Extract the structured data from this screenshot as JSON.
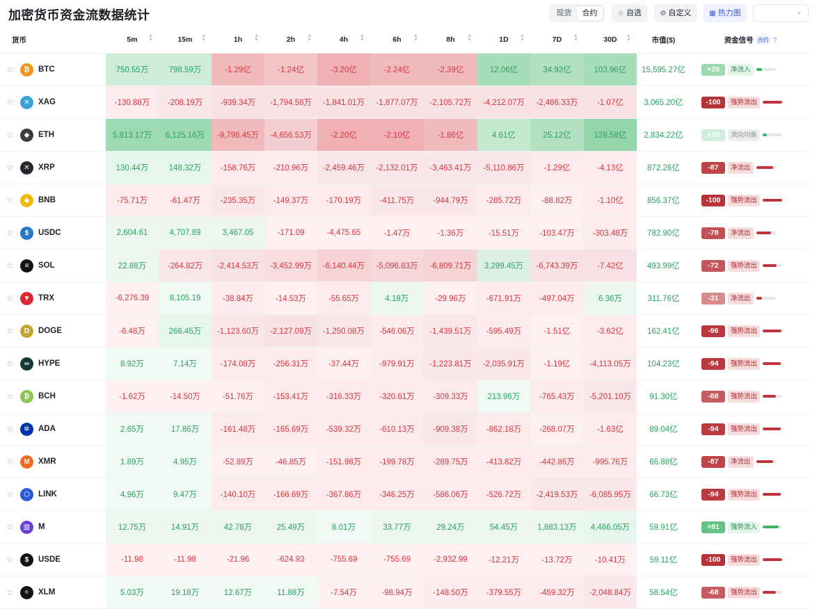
{
  "title": "加密货币资金流数据统计",
  "toolbar": {
    "segments": [
      "现货",
      "合约"
    ],
    "active_segment": 1,
    "watchlist": "自选",
    "custom": "自定义",
    "heatmap": "热力图",
    "select_value": ""
  },
  "colors": {
    "positive_text": "#27a35f",
    "negative_text": "#d9363e",
    "positive_rgb": "60,180,100",
    "negative_rgb": "214,60,70"
  },
  "table": {
    "coin_header": "货币",
    "columns": [
      "5m",
      "15m",
      "1h",
      "2h",
      "4h",
      "6h",
      "8h",
      "1D",
      "7D",
      "30D"
    ],
    "mcap_header": "市值($)",
    "signal_header": "资金信号",
    "signal_badge": "合约",
    "signal_help": "?",
    "rows": [
      {
        "symbol": "BTC",
        "icon": "bitcoin-icon",
        "icon_char": "₿",
        "icon_color": "#f7931a",
        "cells": [
          "750.55万",
          "798.59万",
          "-1.29亿",
          "-1.24亿",
          "-3.20亿",
          "-2.24亿",
          "-2.39亿",
          "12.06亿",
          "34.93亿",
          "103.96亿"
        ],
        "intensity": [
          0.25,
          0.25,
          0.35,
          0.3,
          0.4,
          0.35,
          0.35,
          0.45,
          0.4,
          0.45
        ],
        "mcap": "15,595.27亿",
        "score": "+29",
        "signal": "净流入",
        "signal_type": "in",
        "signal_level": 0.29
      },
      {
        "symbol": "XAG",
        "icon": "silver-icon",
        "icon_char": "✕",
        "icon_color": "#38a1d8",
        "cells": [
          "-130.88万",
          "-208.19万",
          "-939.34万",
          "-1,794.58万",
          "-1,841.01万",
          "-1,877.07万",
          "-2,105.72万",
          "-4,212.07万",
          "-2,486.33万",
          "-1.07亿"
        ],
        "intensity": [
          0.1,
          0.12,
          0.15,
          0.15,
          0.15,
          0.15,
          0.15,
          0.15,
          0.15,
          0.15
        ],
        "mcap": "3,065.20亿",
        "score": "-100",
        "signal": "强势流出",
        "signal_type": "out",
        "signal_level": 1.0
      },
      {
        "symbol": "ETH",
        "icon": "ethereum-icon",
        "icon_char": "◆",
        "icon_color": "#3c3c3d",
        "cells": [
          "5,813.17万",
          "6,125.16万",
          "-9,798.45万",
          "-4,656.53万",
          "-2.20亿",
          "-2.10亿",
          "-1.86亿",
          "4.61亿",
          "25.12亿",
          "128.58亿"
        ],
        "intensity": [
          0.5,
          0.5,
          0.35,
          0.25,
          0.4,
          0.4,
          0.35,
          0.3,
          0.4,
          0.55
        ],
        "mcap": "2,834.22亿",
        "score": "+10",
        "signal": "流向均衡",
        "signal_type": "neutral",
        "signal_level": 0.1
      },
      {
        "symbol": "XRP",
        "icon": "xrp-icon",
        "icon_char": "✕",
        "icon_color": "#23292f",
        "cells": [
          "130.44万",
          "148.32万",
          "-158.76万",
          "-210.96万",
          "-2,459.46万",
          "-2,132.01万",
          "-3,463.41万",
          "-5,110.86万",
          "-1.29亿",
          "-4.13亿"
        ],
        "intensity": [
          0.12,
          0.12,
          0.1,
          0.1,
          0.12,
          0.12,
          0.12,
          0.12,
          0.1,
          0.1
        ],
        "mcap": "872.26亿",
        "score": "-87",
        "signal": "净流出",
        "signal_type": "out",
        "signal_level": 0.87
      },
      {
        "symbol": "BNB",
        "icon": "bnb-icon",
        "icon_char": "◆",
        "icon_color": "#f0b90b",
        "cells": [
          "-75.71万",
          "-61.47万",
          "-235.35万",
          "-149.37万",
          "-170.19万",
          "-411.75万",
          "-944.79万",
          "-285.72万",
          "-88.82万",
          "-1.10亿"
        ],
        "intensity": [
          0.1,
          0.1,
          0.12,
          0.1,
          0.1,
          0.12,
          0.12,
          0.1,
          0.08,
          0.1
        ],
        "mcap": "856.37亿",
        "score": "-100",
        "signal": "强势流出",
        "signal_type": "out",
        "signal_level": 1.0
      },
      {
        "symbol": "USDC",
        "icon": "usdc-icon",
        "icon_char": "$",
        "icon_color": "#2775ca",
        "cells": [
          "2,604.61",
          "4,707.89",
          "3,467.05",
          "-171.09",
          "-4,475.65",
          "-1.47万",
          "-1.36万",
          "-15.51万",
          "-103.47万",
          "-303.48万"
        ],
        "intensity": [
          0.1,
          0.1,
          0.1,
          0.08,
          0.08,
          0.08,
          0.08,
          0.08,
          0.08,
          0.1
        ],
        "mcap": "782.90亿",
        "score": "-78",
        "signal": "净流出",
        "signal_type": "out",
        "signal_level": 0.78
      },
      {
        "symbol": "SOL",
        "icon": "solana-icon",
        "icon_char": "≡",
        "icon_color": "#141414",
        "cells": [
          "22.88万",
          "-264.82万",
          "-2,414.53万",
          "-3,452.99万",
          "-6,140.44万",
          "-5,096.83万",
          "-6,809.71万",
          "3,299.45万",
          "-6,743.39万",
          "-7.42亿"
        ],
        "intensity": [
          0.1,
          0.12,
          0.15,
          0.18,
          0.22,
          0.2,
          0.22,
          0.18,
          0.15,
          0.15
        ],
        "mcap": "493.99亿",
        "score": "-72",
        "signal": "强势流出",
        "signal_type": "out",
        "signal_level": 0.72
      },
      {
        "symbol": "TRX",
        "icon": "tron-icon",
        "icon_char": "▼",
        "icon_color": "#e0262f",
        "cells": [
          "-6,276.39",
          "8,105.19",
          "-38.84万",
          "-14.53万",
          "-55.65万",
          "4.18万",
          "-29.96万",
          "-671.91万",
          "-497.04万",
          "6.36万"
        ],
        "intensity": [
          0.08,
          0.08,
          0.1,
          0.08,
          0.1,
          0.1,
          0.08,
          0.1,
          0.1,
          0.1
        ],
        "mcap": "311.76亿",
        "score": "-31",
        "signal": "净流出",
        "signal_type": "out",
        "signal_level": 0.31
      },
      {
        "symbol": "DOGE",
        "icon": "doge-icon",
        "icon_char": "D",
        "icon_color": "#c2a633",
        "cells": [
          "-6.48万",
          "266.45万",
          "-1,123.60万",
          "-2,127.09万",
          "-1,250.08万",
          "-546.06万",
          "-1,439.51万",
          "-595.49万",
          "-1.51亿",
          "-3.62亿"
        ],
        "intensity": [
          0.08,
          0.12,
          0.12,
          0.15,
          0.12,
          0.1,
          0.12,
          0.1,
          0.08,
          0.1
        ],
        "mcap": "162.41亿",
        "score": "-96",
        "signal": "强势流出",
        "signal_type": "out",
        "signal_level": 0.96
      },
      {
        "symbol": "HYPE",
        "icon": "hyperliquid-icon",
        "icon_char": "∞",
        "icon_color": "#0f3a33",
        "cells": [
          "8.92万",
          "7.14万",
          "-174.08万",
          "-256.31万",
          "-37.44万",
          "-979.91万",
          "-1,223.81万",
          "-2,035.91万",
          "-1.19亿",
          "-4,113.05万"
        ],
        "intensity": [
          0.08,
          0.08,
          0.1,
          0.1,
          0.08,
          0.1,
          0.12,
          0.12,
          0.08,
          0.1
        ],
        "mcap": "104.23亿",
        "score": "-94",
        "signal": "强势流出",
        "signal_type": "out",
        "signal_level": 0.94
      },
      {
        "symbol": "BCH",
        "icon": "bitcoin-cash-icon",
        "icon_char": "₿",
        "icon_color": "#8dc351",
        "cells": [
          "-1.62万",
          "-14.50万",
          "-51.76万",
          "-153.41万",
          "-316.33万",
          "-320.61万",
          "-309.33万",
          "213.96万",
          "-765.43万",
          "-5,201.10万"
        ],
        "intensity": [
          0.08,
          0.08,
          0.08,
          0.1,
          0.1,
          0.1,
          0.1,
          0.08,
          0.1,
          0.12
        ],
        "mcap": "91.30亿",
        "score": "-68",
        "signal": "强势流出",
        "signal_type": "out",
        "signal_level": 0.68
      },
      {
        "symbol": "ADA",
        "icon": "cardano-icon",
        "icon_char": "✲",
        "icon_color": "#0033ad",
        "cells": [
          "2.65万",
          "17.86万",
          "-161.48万",
          "-165.69万",
          "-539.32万",
          "-610.13万",
          "-909.38万",
          "-862.18万",
          "-268.07万",
          "-1.63亿"
        ],
        "intensity": [
          0.08,
          0.08,
          0.1,
          0.1,
          0.1,
          0.1,
          0.12,
          0.1,
          0.08,
          0.1
        ],
        "mcap": "89.04亿",
        "score": "-94",
        "signal": "强势流出",
        "signal_type": "out",
        "signal_level": 0.94
      },
      {
        "symbol": "XMR",
        "icon": "monero-icon",
        "icon_char": "M",
        "icon_color": "#f26822",
        "cells": [
          "1.89万",
          "4.95万",
          "-52.89万",
          "-46.85万",
          "-151.98万",
          "-199.78万",
          "-289.75万",
          "-413.82万",
          "-442.86万",
          "-995.76万"
        ],
        "intensity": [
          0.08,
          0.08,
          0.08,
          0.08,
          0.1,
          0.1,
          0.1,
          0.1,
          0.1,
          0.1
        ],
        "mcap": "66.88亿",
        "score": "-87",
        "signal": "净流出",
        "signal_type": "out",
        "signal_level": 0.87
      },
      {
        "symbol": "LINK",
        "icon": "chainlink-icon",
        "icon_char": "⬡",
        "icon_color": "#2a5ada",
        "cells": [
          "4.96万",
          "9.47万",
          "-140.10万",
          "-166.69万",
          "-367.86万",
          "-346.25万",
          "-586.06万",
          "-526.72万",
          "-2,419.53万",
          "-6,085.95万"
        ],
        "intensity": [
          0.08,
          0.08,
          0.1,
          0.1,
          0.1,
          0.1,
          0.1,
          0.1,
          0.12,
          0.12
        ],
        "mcap": "66.73亿",
        "score": "-94",
        "signal": "强势流出",
        "signal_type": "out",
        "signal_level": 0.94
      },
      {
        "symbol": "M",
        "icon": "m-token-icon",
        "icon_char": "▥",
        "icon_color": "#6b3fd4",
        "cells": [
          "12.75万",
          "14.91万",
          "42.78万",
          "25.49万",
          "8.01万",
          "33.77万",
          "29.24万",
          "54.45万",
          "1,883.13万",
          "4,466.05万"
        ],
        "intensity": [
          0.1,
          0.1,
          0.1,
          0.1,
          0.08,
          0.1,
          0.1,
          0.1,
          0.1,
          0.12
        ],
        "mcap": "59.91亿",
        "score": "+81",
        "signal": "强势流入",
        "signal_type": "in",
        "signal_level": 0.81
      },
      {
        "symbol": "USDE",
        "icon": "usde-icon",
        "icon_char": "$",
        "icon_color": "#111111",
        "cells": [
          "-11.98",
          "-11.98",
          "-21.96",
          "-624.93",
          "-755.69",
          "-755.69",
          "-2,932.99",
          "-12.21万",
          "-13.72万",
          "-10.41万"
        ],
        "intensity": [
          0.08,
          0.08,
          0.08,
          0.08,
          0.08,
          0.08,
          0.08,
          0.08,
          0.08,
          0.08
        ],
        "mcap": "59.11亿",
        "score": "-100",
        "signal": "强势流出",
        "signal_type": "out",
        "signal_level": 1.0
      },
      {
        "symbol": "XLM",
        "icon": "stellar-icon",
        "icon_char": "✧",
        "icon_color": "#141414",
        "cells": [
          "5.03万",
          "19.18万",
          "12.67万",
          "11.88万",
          "-7.54万",
          "-98.94万",
          "-148.50万",
          "-379.55万",
          "-459.32万",
          "-2,048.84万"
        ],
        "intensity": [
          0.08,
          0.08,
          0.08,
          0.08,
          0.08,
          0.08,
          0.1,
          0.1,
          0.1,
          0.12
        ],
        "mcap": "58.54亿",
        "score": "-68",
        "signal": "强势流出",
        "signal_type": "out",
        "signal_level": 0.68
      }
    ]
  }
}
